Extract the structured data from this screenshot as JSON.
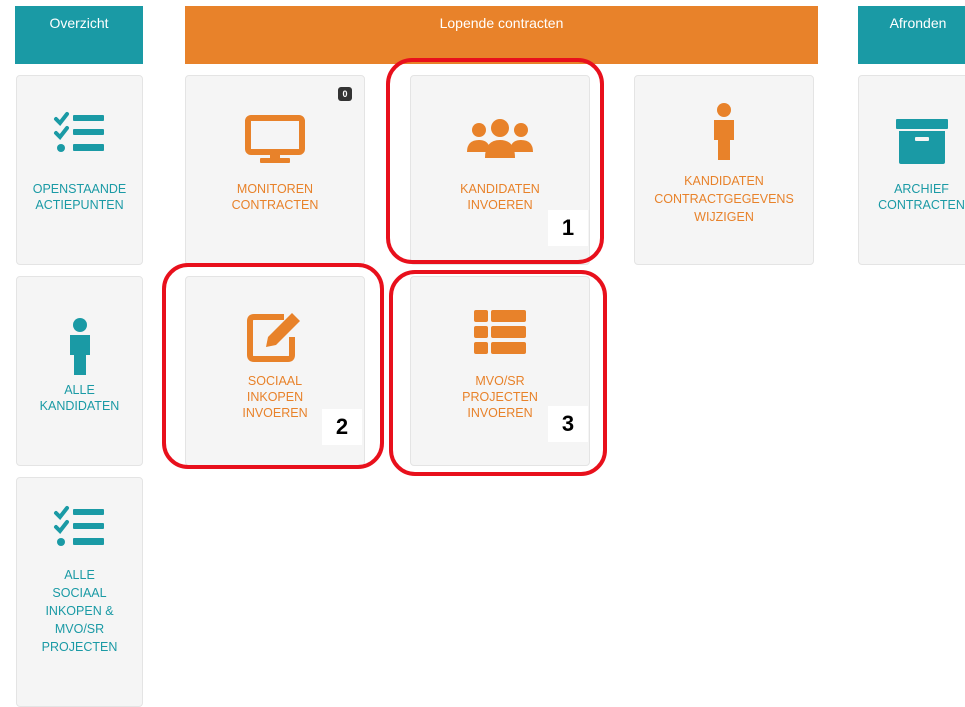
{
  "headers": {
    "overview": "Overzicht",
    "running": "Lopende contracten",
    "finish": "Afronden"
  },
  "tiles": {
    "open_action_points": "OPENSTAANDE\nACTIEPUNTEN",
    "all_candidates": "ALLE\nKANDIDATEN",
    "all_social": "ALLE\nSOCIAAL\nINKOPEN &\nMVO/SR\nPROJECTEN",
    "monitor_contracts": "MONITOREN\nCONTRACTEN",
    "monitor_badge": "0",
    "enter_candidates": "KANDIDATEN\nINVOEREN",
    "candidate_contract_data": "KANDIDATEN\nCONTRACTGEGEVENS\nWIJZIGEN",
    "archive_contracts": "ARCHIEF\nCONTRACTEN",
    "enter_social_purchasing": "SOCIAAL\nINKOPEN\nINVOEREN",
    "enter_mvo_projects": "MVO/SR\nPROJECTEN\nINVOEREN"
  },
  "callouts": {
    "one": "1",
    "two": "2",
    "three": "3"
  },
  "icons": {
    "open_action_points": "checklist-icon",
    "all_candidates": "person-icon",
    "all_social": "checklist-icon",
    "monitor_contracts": "monitor-icon",
    "enter_candidates": "users-icon",
    "candidate_contract_data": "person-icon",
    "archive_contracts": "archive-icon",
    "enter_social_purchasing": "edit-icon",
    "enter_mvo_projects": "list-icon"
  },
  "colors": {
    "teal": "#1a9aa5",
    "orange": "#e8822a",
    "highlight": "#e8101c"
  }
}
